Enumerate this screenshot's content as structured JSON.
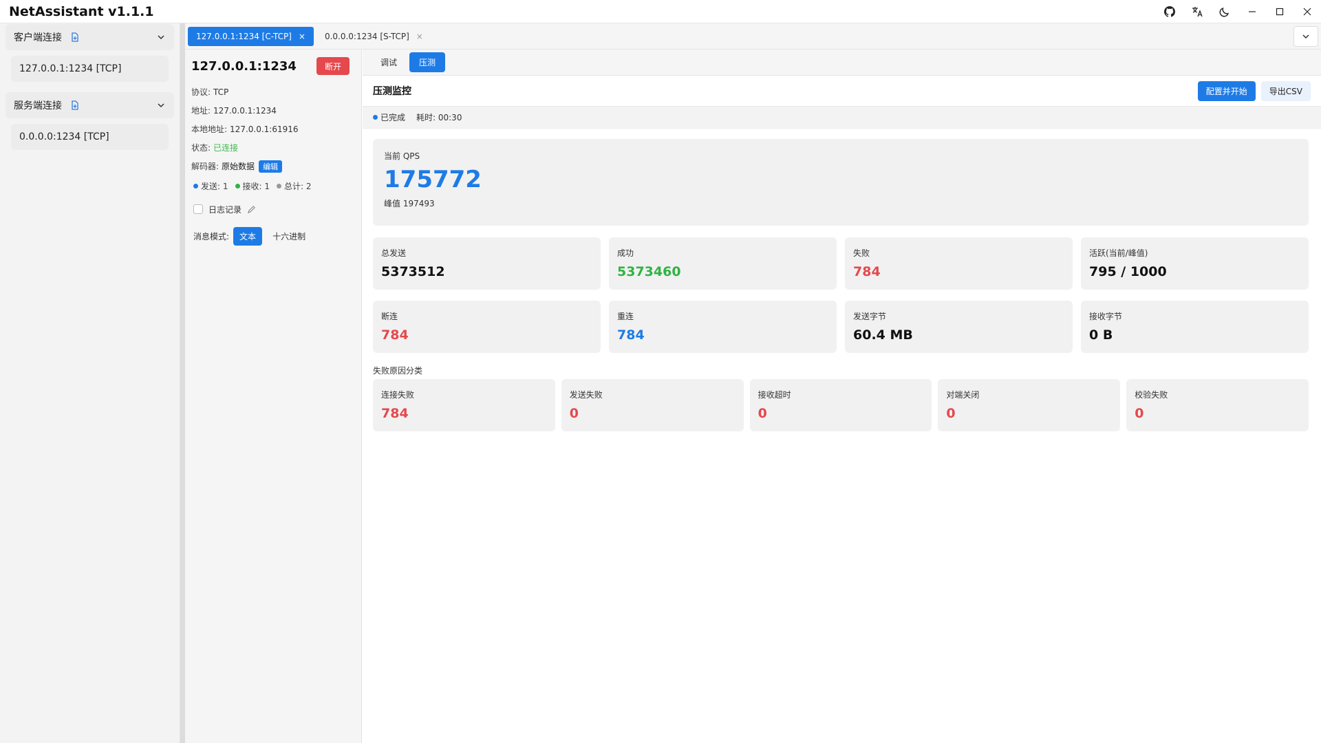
{
  "app": {
    "title": "NetAssistant v1.1.1"
  },
  "titlebar": {
    "icons": [
      "github-icon",
      "translate-icon",
      "moon-icon",
      "minimize-icon",
      "maximize-icon",
      "close-icon"
    ]
  },
  "sidebar": {
    "client_header": "客户端连接",
    "client_items": [
      "127.0.0.1:1234 [TCP]"
    ],
    "server_header": "服务端连接",
    "server_items": [
      "0.0.0.0:1234 [TCP]"
    ]
  },
  "tabs": [
    {
      "label": "127.0.0.1:1234 [C-TCP]",
      "close": "×"
    },
    {
      "label": "0.0.0.0:1234 [S-TCP]",
      "close": "×"
    }
  ],
  "info": {
    "title": "127.0.0.1:1234",
    "disconnect": "断开",
    "protocol_label": "协议:",
    "protocol": "TCP",
    "address_label": "地址:",
    "address": "127.0.0.1:1234",
    "local_label": "本地地址:",
    "local": "127.0.0.1:61916",
    "status_label": "状态:",
    "status": "已连接",
    "decoder_label": "解码器:",
    "decoder": "原始数据",
    "edit": "编辑",
    "sent": "发送: 1",
    "recv": "接收: 1",
    "total": "总计: 2",
    "log_label": "日志记录",
    "mode_label": "消息模式:",
    "mode_text": "文本",
    "mode_hex": "十六进制"
  },
  "colors": {
    "accent": "#1e7be6",
    "success": "#2fb344",
    "danger": "#e5484d",
    "counter_sent": "#1e7be6",
    "counter_recv": "#2fb344",
    "counter_total": "#9a9a9a"
  },
  "subtabs": {
    "debug": "调试",
    "stress": "压测"
  },
  "monitor": {
    "title": "压测监控",
    "configure": "配置并开始",
    "export": "导出CSV",
    "status": "已完成",
    "elapsed": "耗时: 00:30",
    "qps_label": "当前 QPS",
    "qps_value": "175772",
    "qps_peak": "峰值 197493",
    "stats": [
      {
        "label": "总发送",
        "value": "5373512"
      },
      {
        "label": "成功",
        "value": "5373460"
      },
      {
        "label": "失败",
        "value": "784"
      },
      {
        "label": "活跃(当前/峰值)",
        "value": "795 / 1000"
      }
    ],
    "stats2": [
      {
        "label": "断连",
        "value": "784"
      },
      {
        "label": "重连",
        "value": "784"
      },
      {
        "label": "发送字节",
        "value": "60.4 MB"
      },
      {
        "label": "接收字节",
        "value": "0 B"
      }
    ],
    "reasons_title": "失败原因分类",
    "reasons": [
      {
        "label": "连接失败",
        "value": "784"
      },
      {
        "label": "发送失败",
        "value": "0"
      },
      {
        "label": "接收超时",
        "value": "0"
      },
      {
        "label": "对端关闭",
        "value": "0"
      },
      {
        "label": "校验失败",
        "value": "0"
      }
    ]
  }
}
